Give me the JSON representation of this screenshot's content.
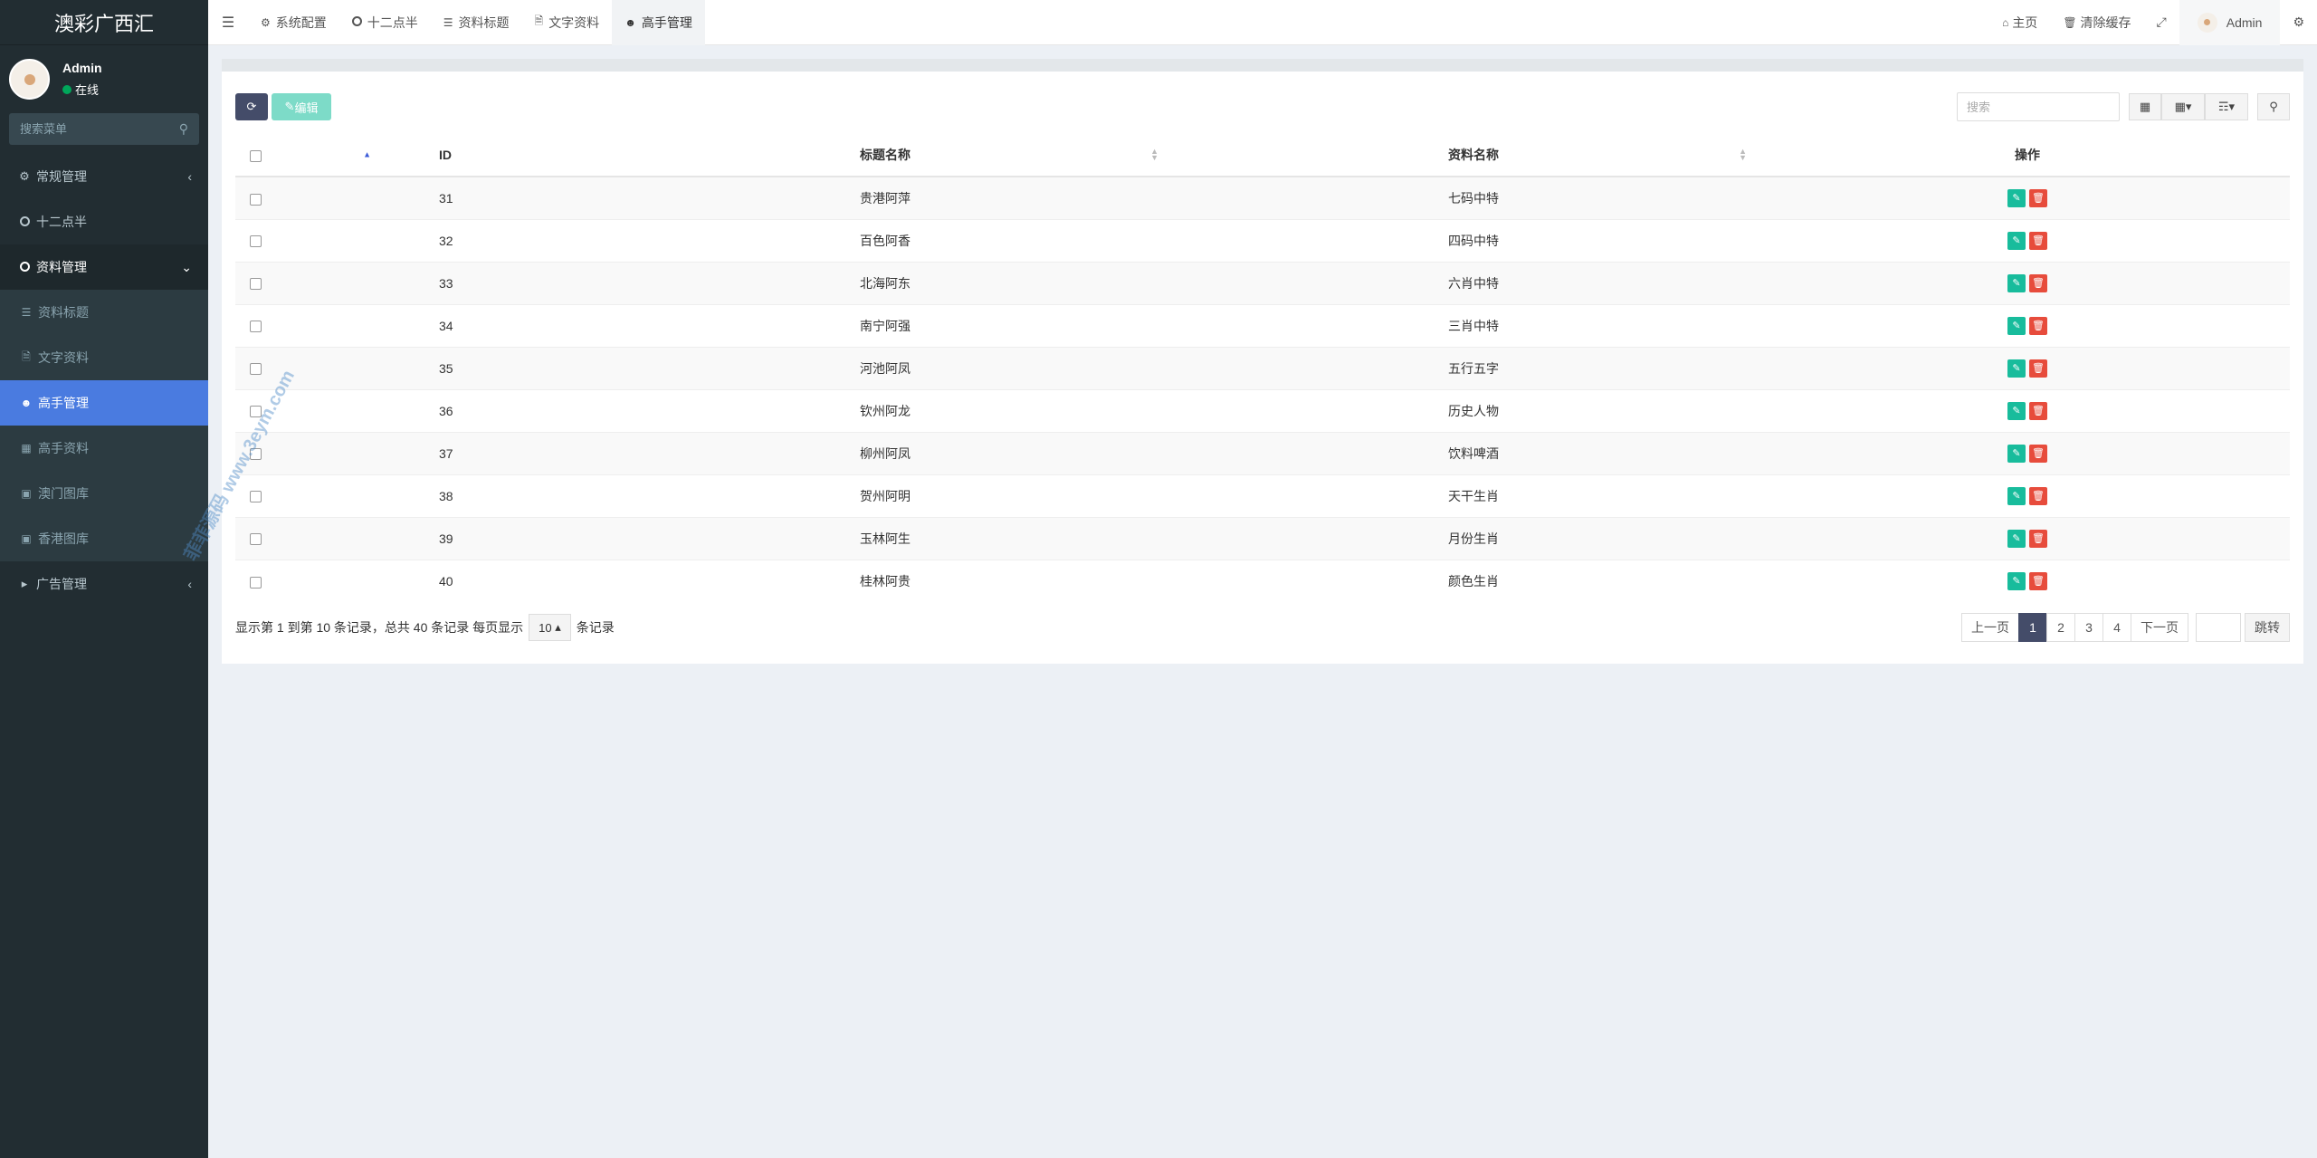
{
  "sidebar": {
    "logo": "澳彩广西汇",
    "user": {
      "name": "Admin",
      "status": "在线"
    },
    "search_placeholder": "搜索菜单",
    "items": [
      {
        "label": "常规管理",
        "icon": "cogs-icon"
      },
      {
        "label": "十二点半",
        "icon": "circle-icon"
      },
      {
        "label": "资料管理",
        "icon": "circle-icon"
      }
    ],
    "sub_items": [
      {
        "label": "资料标题",
        "icon": "list-icon"
      },
      {
        "label": "文字资料",
        "icon": "file-icon"
      },
      {
        "label": "高手管理",
        "icon": "user-icon"
      },
      {
        "label": "高手资料",
        "icon": "database-icon"
      },
      {
        "label": "澳门图库",
        "icon": "image-icon"
      },
      {
        "label": "香港图库",
        "icon": "image-icon"
      }
    ],
    "ad": {
      "label": "广告管理",
      "icon": "bullhorn-icon"
    }
  },
  "topbar": {
    "tabs": [
      {
        "label": "系统配置"
      },
      {
        "label": "十二点半"
      },
      {
        "label": "资料标题"
      },
      {
        "label": "文字资料"
      },
      {
        "label": "高手管理"
      }
    ],
    "home": "主页",
    "clear_cache": "清除缓存",
    "user": "Admin"
  },
  "toolbar": {
    "edit_label": "编辑",
    "search_placeholder": "搜索"
  },
  "table": {
    "headers": {
      "id": "ID",
      "title": "标题名称",
      "data": "资料名称",
      "op": "操作"
    },
    "rows": [
      {
        "id": "31",
        "title": "贵港阿萍",
        "data": "七码中特"
      },
      {
        "id": "32",
        "title": "百色阿香",
        "data": "四码中特"
      },
      {
        "id": "33",
        "title": "北海阿东",
        "data": "六肖中特"
      },
      {
        "id": "34",
        "title": "南宁阿强",
        "data": "三肖中特"
      },
      {
        "id": "35",
        "title": "河池阿凤",
        "data": "五行五字"
      },
      {
        "id": "36",
        "title": "钦州阿龙",
        "data": "历史人物"
      },
      {
        "id": "37",
        "title": "柳州阿凤",
        "data": "饮料啤酒"
      },
      {
        "id": "38",
        "title": "贺州阿明",
        "data": "天干生肖"
      },
      {
        "id": "39",
        "title": "玉林阿生",
        "data": "月份生肖"
      },
      {
        "id": "40",
        "title": "桂林阿贵",
        "data": "颜色生肖"
      }
    ]
  },
  "footer": {
    "summary": "显示第 1 到第 10 条记录，总共 40 条记录 每页显示",
    "page_size": "10",
    "suffix": "条记录",
    "prev": "上一页",
    "pages": [
      "1",
      "2",
      "3",
      "4"
    ],
    "next": "下一页",
    "jump": "跳转"
  },
  "watermark": "菲菲源码 www.3eym.com",
  "colors": {
    "sidebar": "#222d32",
    "active": "#4a7be0",
    "primary": "#444c69",
    "success": "#18bc9c",
    "danger": "#e74c3c"
  }
}
